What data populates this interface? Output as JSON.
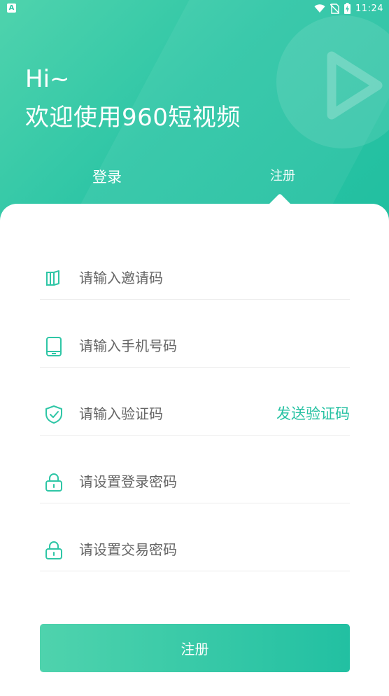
{
  "status_bar": {
    "notification_letter": "A",
    "time": "11:24",
    "icons": [
      "wifi-icon",
      "no-sim-icon",
      "battery-charging-icon"
    ]
  },
  "header": {
    "greeting": "Hi~",
    "welcome": "欢迎使用960短视频",
    "decoration_icon": "play-icon"
  },
  "tabs": {
    "login_label": "登录",
    "register_label": "注册",
    "active": "register"
  },
  "form": {
    "invite": {
      "placeholder": "请输入邀请码",
      "value": "",
      "icon": "invite-code-icon"
    },
    "phone": {
      "placeholder": "请输入手机号码",
      "value": "",
      "icon": "phone-icon"
    },
    "code": {
      "placeholder": "请输入验证码",
      "value": "",
      "icon": "shield-check-icon",
      "send_label": "发送验证码"
    },
    "login_password": {
      "placeholder": "请设置登录密码",
      "value": "",
      "icon": "lock-icon"
    },
    "trade_password": {
      "placeholder": "请设置交易密码",
      "value": "",
      "icon": "lock-icon"
    }
  },
  "submit_label": "注册",
  "colors": {
    "accent": "#2fc6a6",
    "accent_light": "#4fd3ad",
    "placeholder": "#666666",
    "divider": "#ececec"
  }
}
